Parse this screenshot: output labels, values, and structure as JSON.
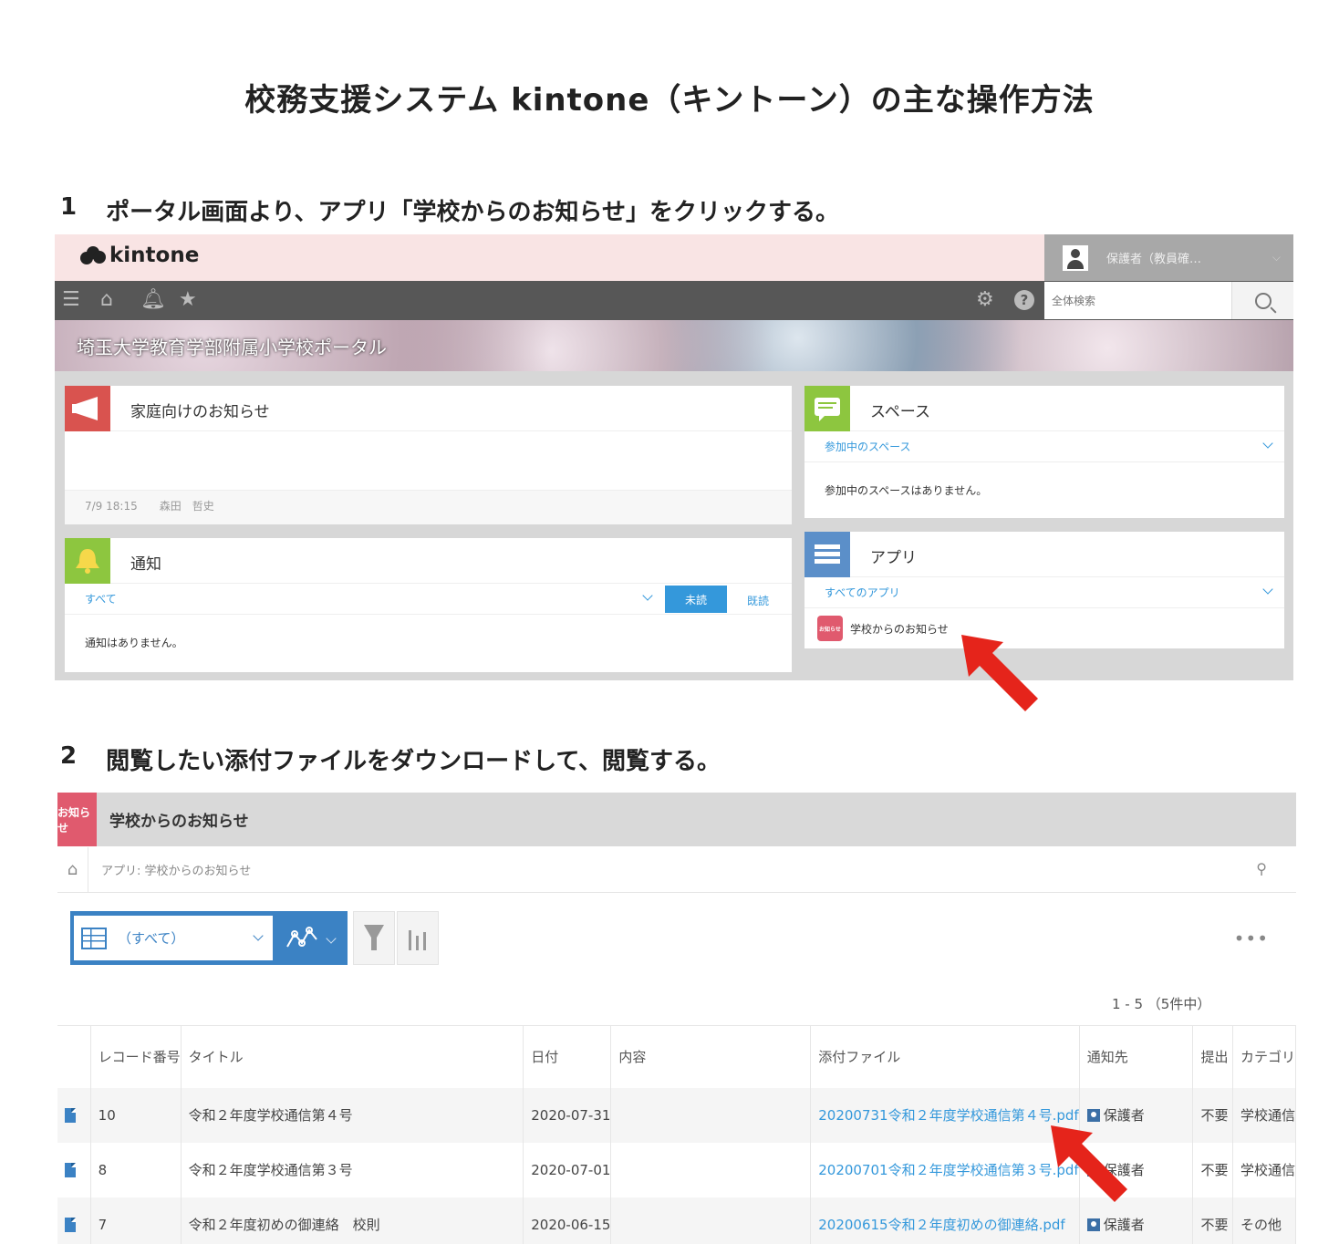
{
  "doc": {
    "title": "校務支援システム kintone（キントーン）の主な操作方法",
    "step1_num": "1",
    "step1_text": "ポータル画面より、アプリ「学校からのお知らせ」をクリックする。",
    "step2_num": "2",
    "step2_text": "閲覧したい添付ファイルをダウンロードして、閲覧する。"
  },
  "portal": {
    "logo": "kintone",
    "user_name": "保護者（教員確…",
    "search_placeholder": "全体検索",
    "banner_title": "埼玉大学教育学部附属小学校ポータル",
    "announcements": {
      "title": "家庭向けのお知らせ",
      "meta": "7/9 18:15　　森田　哲史"
    },
    "notifications": {
      "title": "通知",
      "filter": "すべて",
      "unread_label": "未読",
      "read_label": "既読",
      "empty": "通知はありません。"
    },
    "spaces": {
      "title": "スペース",
      "filter": "参加中のスペース",
      "empty": "参加中のスペースはありません。"
    },
    "apps": {
      "title": "アプリ",
      "filter": "すべてのアプリ",
      "items": [
        {
          "icon_text": "お知らせ",
          "label": "学校からのお知らせ"
        }
      ]
    }
  },
  "app": {
    "logo_text": "お知らせ",
    "title": "学校からのお知らせ",
    "breadcrumb": "アプリ: 学校からのお知らせ",
    "view_name": "（すべて）",
    "count": "1 - 5 （5件中）",
    "columns": [
      "",
      "レコード番号",
      "タイトル",
      "日付",
      "内容",
      "添付ファイル",
      "通知先",
      "提出",
      "カテゴリ"
    ],
    "rows": [
      {
        "id": "10",
        "title": "令和２年度学校通信第４号",
        "date": "2020-07-31",
        "content": "",
        "file": "20200731令和２年度学校通信第４号.pdf",
        "target": "保護者",
        "submit": "不要",
        "category": "学校通信"
      },
      {
        "id": "8",
        "title": "令和２年度学校通信第３号",
        "date": "2020-07-01",
        "content": "",
        "file": "20200701令和２年度学校通信第３号.pdf",
        "target": "保護者",
        "submit": "不要",
        "category": "学校通信"
      },
      {
        "id": "7",
        "title": "令和２年度初めの御連絡　校則",
        "date": "2020-06-15",
        "content": "",
        "file": "20200615令和２年度初めの御連絡.pdf",
        "target": "保護者",
        "submit": "不要",
        "category": "その他"
      }
    ]
  },
  "colors": {
    "accent": "#3b82c4",
    "arrow": "#e5241b",
    "app_icon": "#e05a6e"
  }
}
